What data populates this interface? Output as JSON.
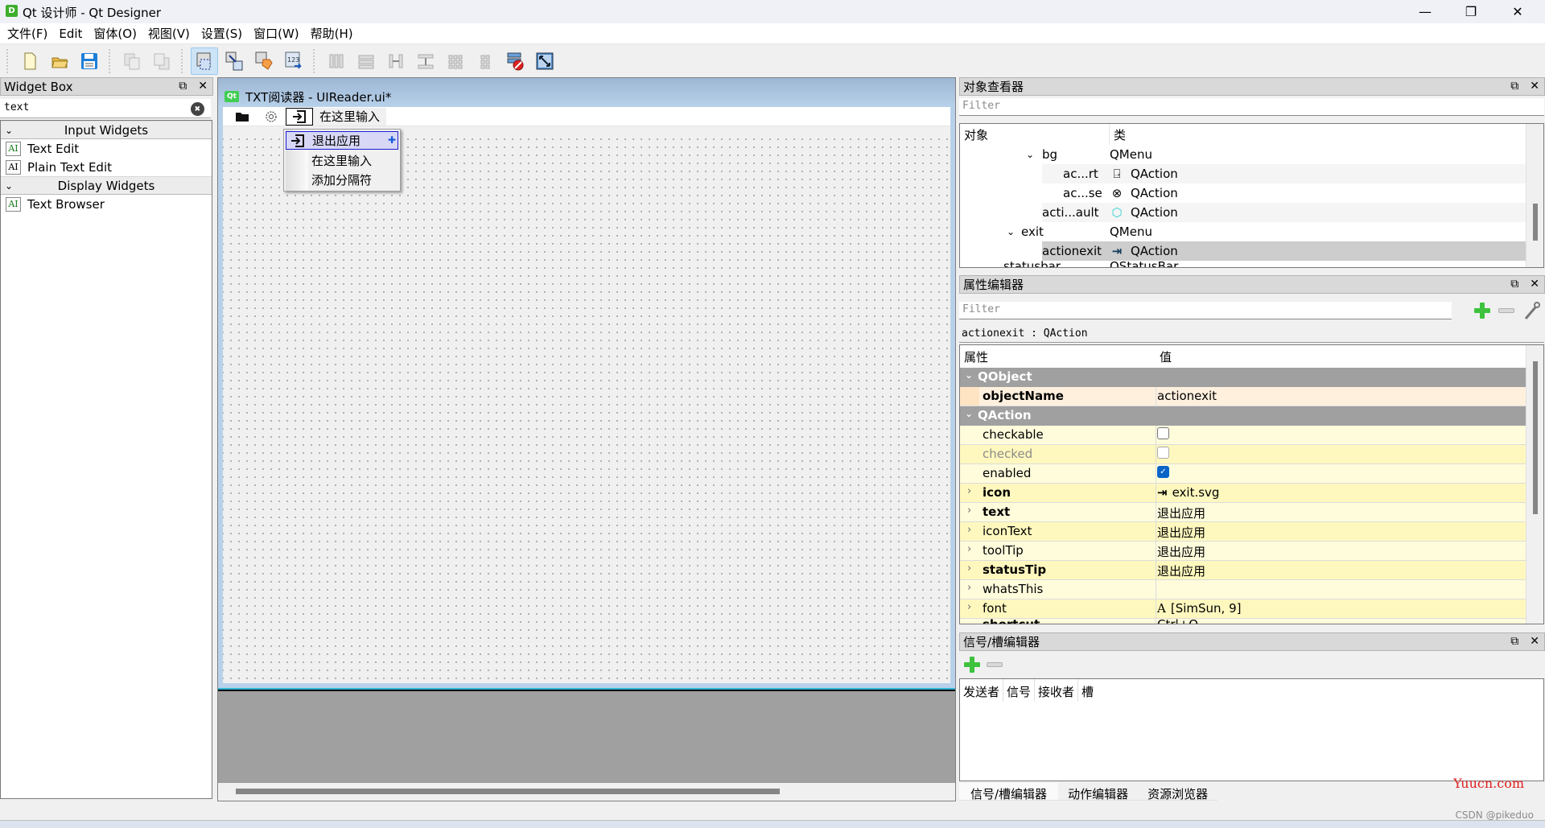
{
  "window": {
    "title": "Qt 设计师 - Qt Designer",
    "app_icon": "D",
    "controls": {
      "minimize": "—",
      "restore": "❐",
      "close": "✕"
    }
  },
  "menubar": {
    "items": [
      "文件(F)",
      "Edit",
      "窗体(O)",
      "视图(V)",
      "设置(S)",
      "窗口(W)",
      "帮助(H)"
    ]
  },
  "toolbar": {
    "groups": [
      [
        "new-file-icon",
        "open-folder-icon",
        "save-icon"
      ],
      [
        "send-to-back-icon",
        "bring-to-front-icon"
      ],
      [
        "edit-widgets-icon",
        "edit-signals-slots-icon",
        "edit-buddies-icon",
        "edit-tab-order-icon"
      ],
      [
        "layout-horizontal-icon",
        "layout-vertical-icon",
        "layout-h-splitter-icon",
        "layout-v-splitter-icon",
        "layout-grid-icon",
        "layout-form-icon",
        "break-layout-icon",
        "adjust-size-icon"
      ]
    ],
    "active": "edit-widgets-icon"
  },
  "widget_box": {
    "title": "Widget Box",
    "search_value": "text",
    "clear_icon": "✖",
    "categories": [
      {
        "label": "Input Widgets",
        "items": [
          {
            "label": "Text Edit",
            "icon": "AI",
            "green": true
          },
          {
            "label": "Plain Text Edit",
            "icon": "AI",
            "green": false
          }
        ]
      },
      {
        "label": "Display Widgets",
        "items": [
          {
            "label": "Text Browser",
            "icon": "AI",
            "green": true
          }
        ]
      }
    ]
  },
  "form": {
    "qt_badge": "Qt",
    "title": "TXT阅读器 - UIReader.ui*",
    "menubar": {
      "items": [
        {
          "icon": "folder-icon",
          "glyph": "▰"
        },
        {
          "icon": "gear-icon",
          "glyph": "⚙"
        },
        {
          "icon": "exit-icon",
          "glyph": "⇥"
        }
      ],
      "placeholder": "在这里输入"
    },
    "popup": {
      "items": [
        {
          "label": "退出应用",
          "icon": "exit-icon",
          "highlighted": true
        },
        {
          "label": "在这里输入"
        },
        {
          "label": "添加分隔符"
        }
      ]
    }
  },
  "object_inspector": {
    "title": "对象查看器",
    "filter_placeholder": "Filter",
    "columns": [
      "对象",
      "类"
    ],
    "rows": [
      {
        "name": "bg",
        "class": "QMenu",
        "expanded": true,
        "icon": ""
      },
      {
        "name": "ac...rt",
        "class": "QAction",
        "icon": "import-icon"
      },
      {
        "name": "ac...se",
        "class": "QAction",
        "icon": "close-circle-icon"
      },
      {
        "name": "acti...ault",
        "class": "QAction",
        "icon": "reset-default-icon"
      },
      {
        "name": "exit",
        "class": "QMenu",
        "expanded": true,
        "icon": ""
      },
      {
        "name": "actionexit",
        "class": "QAction",
        "icon": "exit-icon",
        "selected": true
      },
      {
        "name": "statusbar",
        "class": "QStatusBar",
        "icon": ""
      }
    ]
  },
  "property_editor": {
    "title": "属性编辑器",
    "filter_placeholder": "Filter",
    "object_label": "actionexit : QAction",
    "columns": [
      "属性",
      "值"
    ],
    "groups": [
      {
        "name": "QObject",
        "props": [
          {
            "key": "objectName",
            "value": "actionexit",
            "bold": true
          }
        ]
      },
      {
        "name": "QAction",
        "props": [
          {
            "key": "checkable",
            "type": "checkbox",
            "checked": false
          },
          {
            "key": "checked",
            "type": "checkbox",
            "checked": false,
            "disabled": true
          },
          {
            "key": "enabled",
            "type": "checkbox",
            "checked": true
          },
          {
            "key": "icon",
            "value": "exit.svg",
            "bold": true,
            "expandable": true,
            "icon": "exit-icon"
          },
          {
            "key": "text",
            "value": "退出应用",
            "bold": true,
            "expandable": true
          },
          {
            "key": "iconText",
            "value": "退出应用",
            "expandable": true
          },
          {
            "key": "toolTip",
            "value": "退出应用",
            "expandable": true
          },
          {
            "key": "statusTip",
            "value": "退出应用",
            "bold": true,
            "expandable": true
          },
          {
            "key": "whatsThis",
            "value": "",
            "expandable": true
          },
          {
            "key": "font",
            "value": "[SimSun, 9]",
            "expandable": true,
            "icon": "font-icon"
          },
          {
            "key": "shortcut",
            "value": "Ctrl+Q",
            "bold": true,
            "expandable": true
          }
        ]
      }
    ]
  },
  "signal_slot_editor": {
    "title": "信号/槽编辑器",
    "columns": [
      "发送者",
      "信号",
      "接收者",
      "槽"
    ],
    "tabs": [
      "信号/槽编辑器",
      "动作编辑器",
      "资源浏览器"
    ],
    "active_tab": 0
  },
  "watermark": "Yuucn.com",
  "credit": "CSDN @pikeduo"
}
